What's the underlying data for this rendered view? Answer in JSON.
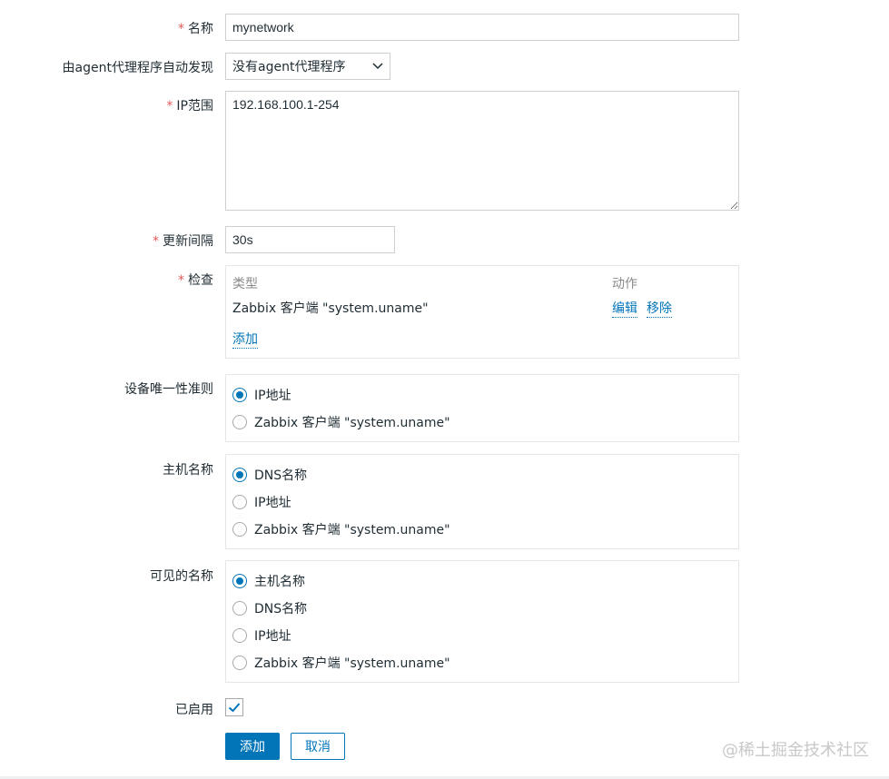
{
  "form": {
    "name": {
      "label": "名称",
      "value": "mynetwork"
    },
    "proxy": {
      "label": "由agent代理程序自动发现",
      "value": "没有agent代理程序"
    },
    "ip_range": {
      "label": "IP范围",
      "value": "192.168.100.1-254"
    },
    "interval": {
      "label": "更新间隔",
      "value": "30s"
    },
    "checks": {
      "label": "检查",
      "col_type": "类型",
      "col_action": "动作",
      "rows": [
        {
          "type": "Zabbix 客户端 \"system.uname\"",
          "edit": "编辑",
          "remove": "移除"
        }
      ],
      "add": "添加"
    },
    "uniqueness": {
      "label": "设备唯一性准则",
      "options": [
        "IP地址",
        "Zabbix 客户端 \"system.uname\""
      ],
      "selected": 0
    },
    "host_name": {
      "label": "主机名称",
      "options": [
        "DNS名称",
        "IP地址",
        "Zabbix 客户端 \"system.uname\""
      ],
      "selected": 0
    },
    "visible_name": {
      "label": "可见的名称",
      "options": [
        "主机名称",
        "DNS名称",
        "IP地址",
        "Zabbix 客户端 \"system.uname\""
      ],
      "selected": 0
    },
    "enabled": {
      "label": "已启用",
      "checked": true
    },
    "buttons": {
      "add": "添加",
      "cancel": "取消"
    }
  },
  "required_mark": "*",
  "watermark": "@稀土掘金技术社区",
  "colors": {
    "accent": "#0275b8",
    "required": "#e45959"
  }
}
